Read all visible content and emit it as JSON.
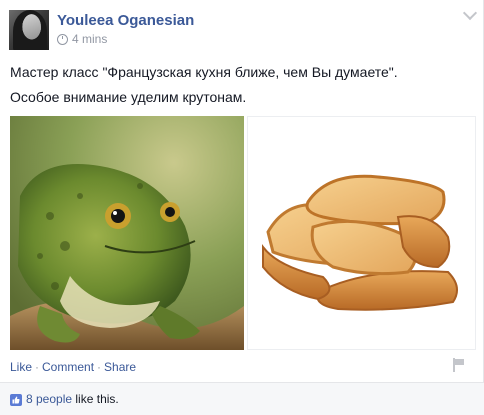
{
  "post": {
    "author": "Youleea Oganesian",
    "time": "4 mins",
    "text_line1": "Мастер класс \"Французская кухня ближе, чем Вы думаете\".",
    "text_line2": "Особое внимание уделим крутонам.",
    "photos": [
      {
        "name": "frog-photo",
        "subject": "frog"
      },
      {
        "name": "bread-photo",
        "subject": "croutons"
      }
    ]
  },
  "actions": {
    "like": "Like",
    "sep1": "·",
    "comment": "Comment",
    "sep2": "·",
    "share": "Share"
  },
  "likes": {
    "count": "8 people",
    "suffix": "like this."
  },
  "colors": {
    "link": "#3b5998",
    "meta": "#9197a3",
    "text": "#141823",
    "footer_bg": "#f6f7f9"
  },
  "icons": [
    "clock-icon",
    "chevron-down-icon",
    "flag-icon",
    "thumbs-up-icon"
  ]
}
